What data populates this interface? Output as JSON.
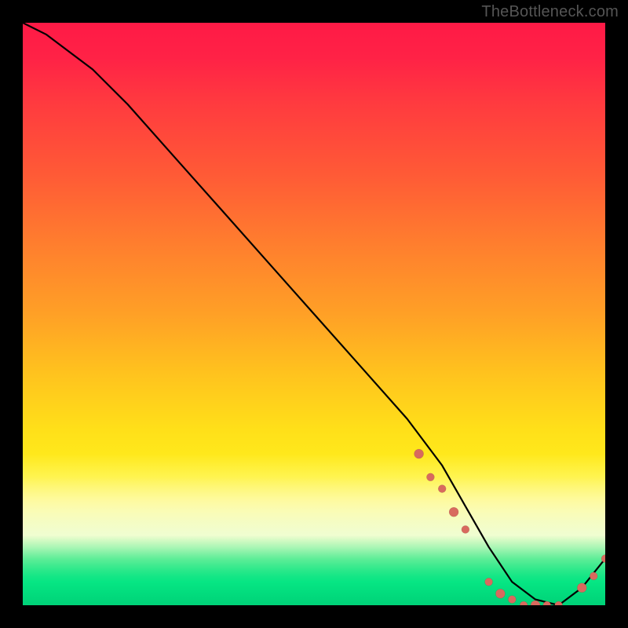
{
  "watermark": "TheBottleneck.com",
  "colors": {
    "frame_bg": "#000000",
    "curve_stroke": "#000000",
    "point_fill": "#d86a5e",
    "gradient_top": "#ff1a46",
    "gradient_mid": "#ffe019",
    "gradient_bottom": "#1fd27a"
  },
  "chart_data": {
    "type": "line",
    "title": "",
    "xlabel": "",
    "ylabel": "",
    "xlim": [
      0,
      100
    ],
    "ylim": [
      0,
      100
    ],
    "x": [
      0,
      4,
      8,
      12,
      18,
      26,
      34,
      42,
      50,
      58,
      66,
      72,
      76,
      80,
      84,
      88,
      92,
      96,
      100
    ],
    "values": [
      100,
      98,
      95,
      92,
      86,
      77,
      68,
      59,
      50,
      41,
      32,
      24,
      17,
      10,
      4,
      1,
      0,
      3,
      8
    ],
    "points_x": [
      68,
      70,
      72,
      74,
      76,
      80,
      82,
      84,
      86,
      88,
      90,
      92,
      96,
      98,
      100
    ],
    "points_y": [
      26,
      22,
      20,
      16,
      13,
      4,
      2,
      1,
      0,
      0,
      0,
      0,
      3,
      5,
      8
    ]
  }
}
